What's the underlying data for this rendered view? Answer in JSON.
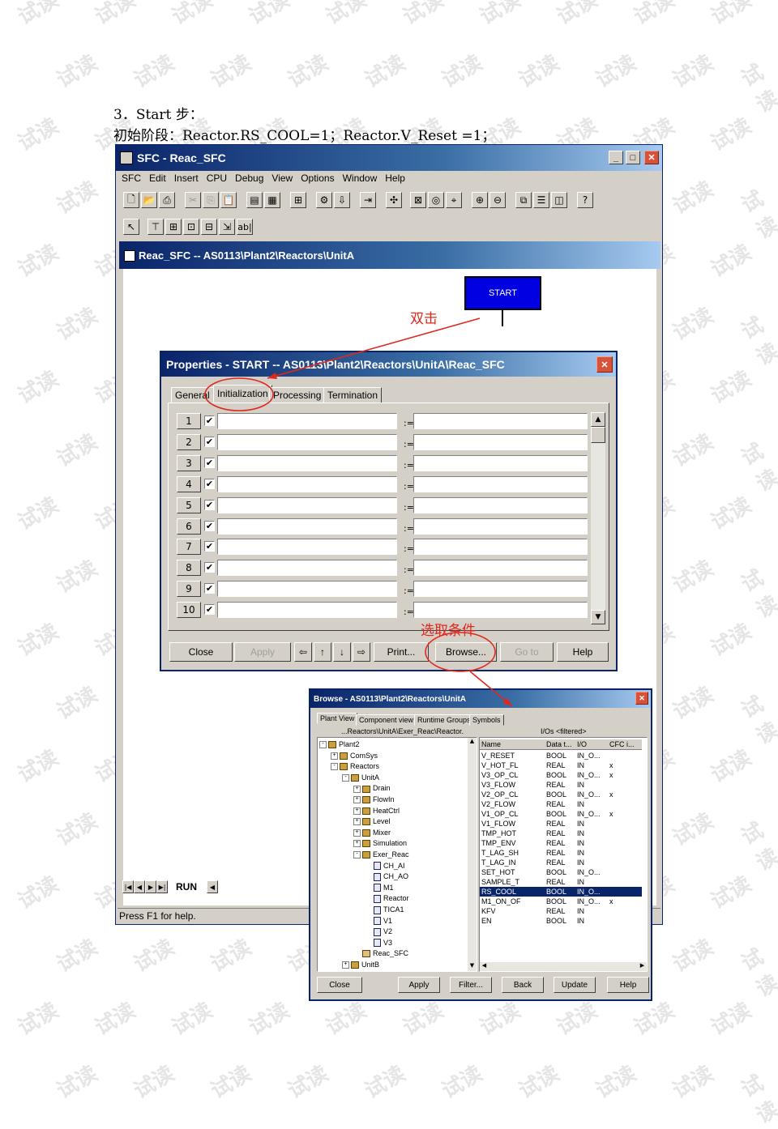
{
  "doc": {
    "heading": "3．Start 步：",
    "line": "初始阶段：Reactor.RS_COOL=1；Reactor.V_Reset =1；"
  },
  "main_window": {
    "title": "SFC - Reac_SFC",
    "menu": [
      "SFC",
      "Edit",
      "Insert",
      "CPU",
      "Debug",
      "View",
      "Options",
      "Window",
      "Help"
    ],
    "child_title": "Reac_SFC -- AS0113\\Plant2\\Reactors\\UnitA",
    "start_node": "START",
    "run_tab": "RUN",
    "status": "Press F1 for help."
  },
  "annotations": {
    "double_click": "双击",
    "select_condition": "选取条件"
  },
  "properties": {
    "title": "Properties -  START -- AS0113\\Plant2\\Reactors\\UnitA\\Reac_SFC",
    "tabs": [
      "General",
      "Initialization",
      "Processing",
      "Termination"
    ],
    "rows": [
      "1",
      "2",
      "3",
      "4",
      "5",
      "6",
      "7",
      "8",
      "9",
      "10"
    ],
    "assign_symbol": ":=",
    "buttons": {
      "close": "Close",
      "apply": "Apply",
      "print": "Print...",
      "browse": "Browse...",
      "goto": "Go to",
      "help": "Help"
    }
  },
  "browse": {
    "title": "Browse - AS0113\\Plant2\\Reactors\\UnitA",
    "tabs": [
      "Plant View",
      "Component view",
      "Runtime Groups",
      "Symbols"
    ],
    "path": "...Reactors\\UnitA\\Exer_Reac\\Reactor.",
    "filter": "I/Os <filtered>",
    "tree": [
      {
        "label": "Plant2",
        "level": 0,
        "pm": "-",
        "icon": "folder"
      },
      {
        "label": "ComSys",
        "level": 1,
        "pm": "+",
        "icon": "folder"
      },
      {
        "label": "Reactors",
        "level": 1,
        "pm": "-",
        "icon": "folder"
      },
      {
        "label": "UnitA",
        "level": 2,
        "pm": "-",
        "icon": "folder"
      },
      {
        "label": "Drain",
        "level": 3,
        "pm": "+",
        "icon": "folder"
      },
      {
        "label": "FlowIn",
        "level": 3,
        "pm": "+",
        "icon": "folder"
      },
      {
        "label": "HeatCtrl",
        "level": 3,
        "pm": "+",
        "icon": "folder"
      },
      {
        "label": "Level",
        "level": 3,
        "pm": "+",
        "icon": "folder"
      },
      {
        "label": "Mixer",
        "level": 3,
        "pm": "+",
        "icon": "folder"
      },
      {
        "label": "Simulation",
        "level": 3,
        "pm": "+",
        "icon": "folder"
      },
      {
        "label": "Exer_Reac",
        "level": 3,
        "pm": "-",
        "icon": "folder"
      },
      {
        "label": "CH_AI",
        "level": 4,
        "pm": "",
        "icon": "block"
      },
      {
        "label": "CH_AO",
        "level": 4,
        "pm": "",
        "icon": "block"
      },
      {
        "label": "M1",
        "level": 4,
        "pm": "",
        "icon": "block"
      },
      {
        "label": "Reactor",
        "level": 4,
        "pm": "",
        "icon": "block"
      },
      {
        "label": "TICA1",
        "level": 4,
        "pm": "",
        "icon": "block"
      },
      {
        "label": "V1",
        "level": 4,
        "pm": "",
        "icon": "block"
      },
      {
        "label": "V2",
        "level": 4,
        "pm": "",
        "icon": "block"
      },
      {
        "label": "V3",
        "level": 4,
        "pm": "",
        "icon": "block"
      },
      {
        "label": "Reac_SFC",
        "level": 3,
        "pm": "",
        "icon": "sfc"
      },
      {
        "label": "UnitB",
        "level": 2,
        "pm": "+",
        "icon": "folder"
      }
    ],
    "columns": [
      "Name",
      "Data t...",
      "I/O",
      "CFC i..."
    ],
    "rows": [
      [
        "V_RESET",
        "BOOL",
        "IN_O...",
        ""
      ],
      [
        "V_HOT_FL",
        "REAL",
        "IN",
        "x"
      ],
      [
        "V3_OP_CL",
        "BOOL",
        "IN_O...",
        "x"
      ],
      [
        "V3_FLOW",
        "REAL",
        "IN",
        ""
      ],
      [
        "V2_OP_CL",
        "BOOL",
        "IN_O...",
        "x"
      ],
      [
        "V2_FLOW",
        "REAL",
        "IN",
        ""
      ],
      [
        "V1_OP_CL",
        "BOOL",
        "IN_O...",
        "x"
      ],
      [
        "V1_FLOW",
        "REAL",
        "IN",
        ""
      ],
      [
        "TMP_HOT",
        "REAL",
        "IN",
        ""
      ],
      [
        "TMP_ENV",
        "REAL",
        "IN",
        ""
      ],
      [
        "T_LAG_SH",
        "REAL",
        "IN",
        ""
      ],
      [
        "T_LAG_IN",
        "REAL",
        "IN",
        ""
      ],
      [
        "SET_HOT",
        "BOOL",
        "IN_O...",
        ""
      ],
      [
        "SAMPLE_T",
        "REAL",
        "IN",
        ""
      ],
      [
        "RS_COOL",
        "BOOL",
        "IN_O...",
        ""
      ],
      [
        "M1_ON_OF",
        "BOOL",
        "IN_O...",
        "x"
      ],
      [
        "KFV",
        "REAL",
        "IN",
        ""
      ],
      [
        "EN",
        "BOOL",
        "IN",
        ""
      ]
    ],
    "selected_row": "RS_COOL",
    "buttons": [
      "Close",
      "Apply",
      "Filter...",
      "Back",
      "Update",
      "Help"
    ]
  },
  "watermark": "试读"
}
